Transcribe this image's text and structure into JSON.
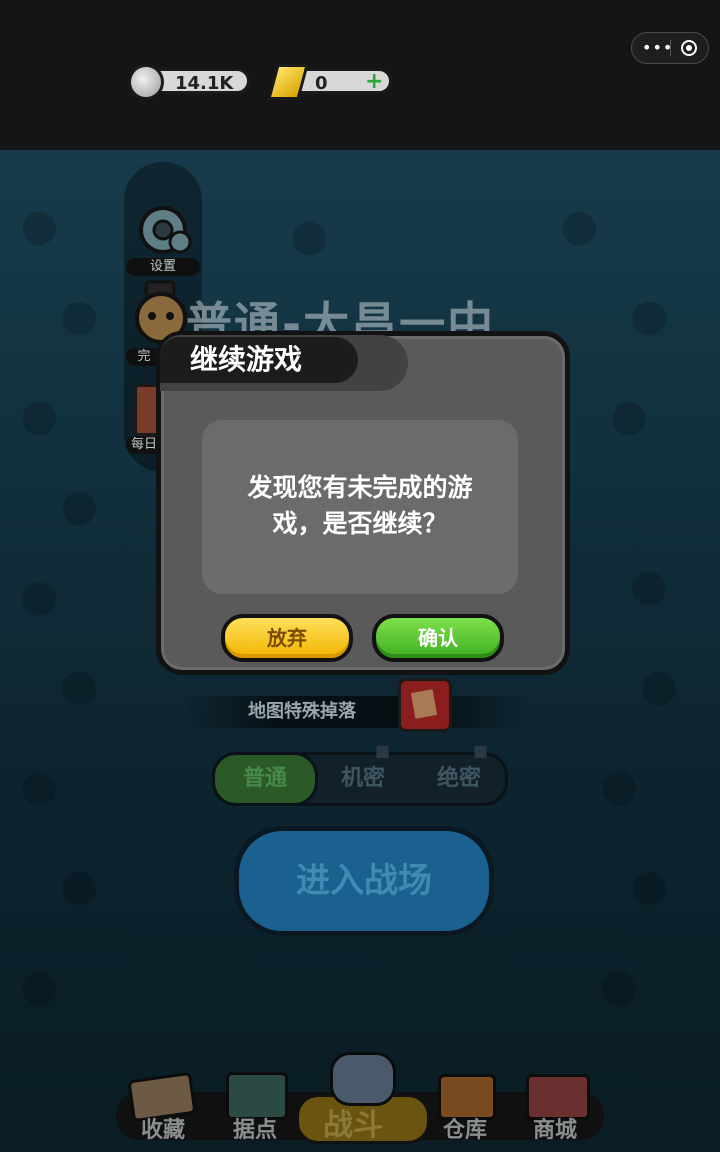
{
  "topbar": {
    "coins": "14.1K",
    "gold": "0",
    "capsule_more": "•••",
    "plus": "+"
  },
  "side_menu": {
    "settings_label": "设置",
    "achievement_label": "完",
    "daily_label": "每日"
  },
  "scene": {
    "title": "普通-大昌一中",
    "map_drop_label": "地图特殊掉落",
    "modes": [
      "普通",
      "机密",
      "绝密"
    ],
    "active_mode": "普通",
    "enter_button": "进入战场"
  },
  "bottom_nav": {
    "items": [
      "收藏",
      "据点",
      "战斗",
      "仓库",
      "商城"
    ],
    "active": "战斗"
  },
  "dialog": {
    "title": "继续游戏",
    "message_line1": "发现您有未完成的游",
    "message_line2": "戏，是否继续？",
    "abandon_label": "放弃",
    "confirm_label": "确认"
  },
  "colors": {
    "confirm_green": "#4fc52b",
    "abandon_yellow": "#f7c21a",
    "dialog_gray": "#5a5a5a"
  }
}
